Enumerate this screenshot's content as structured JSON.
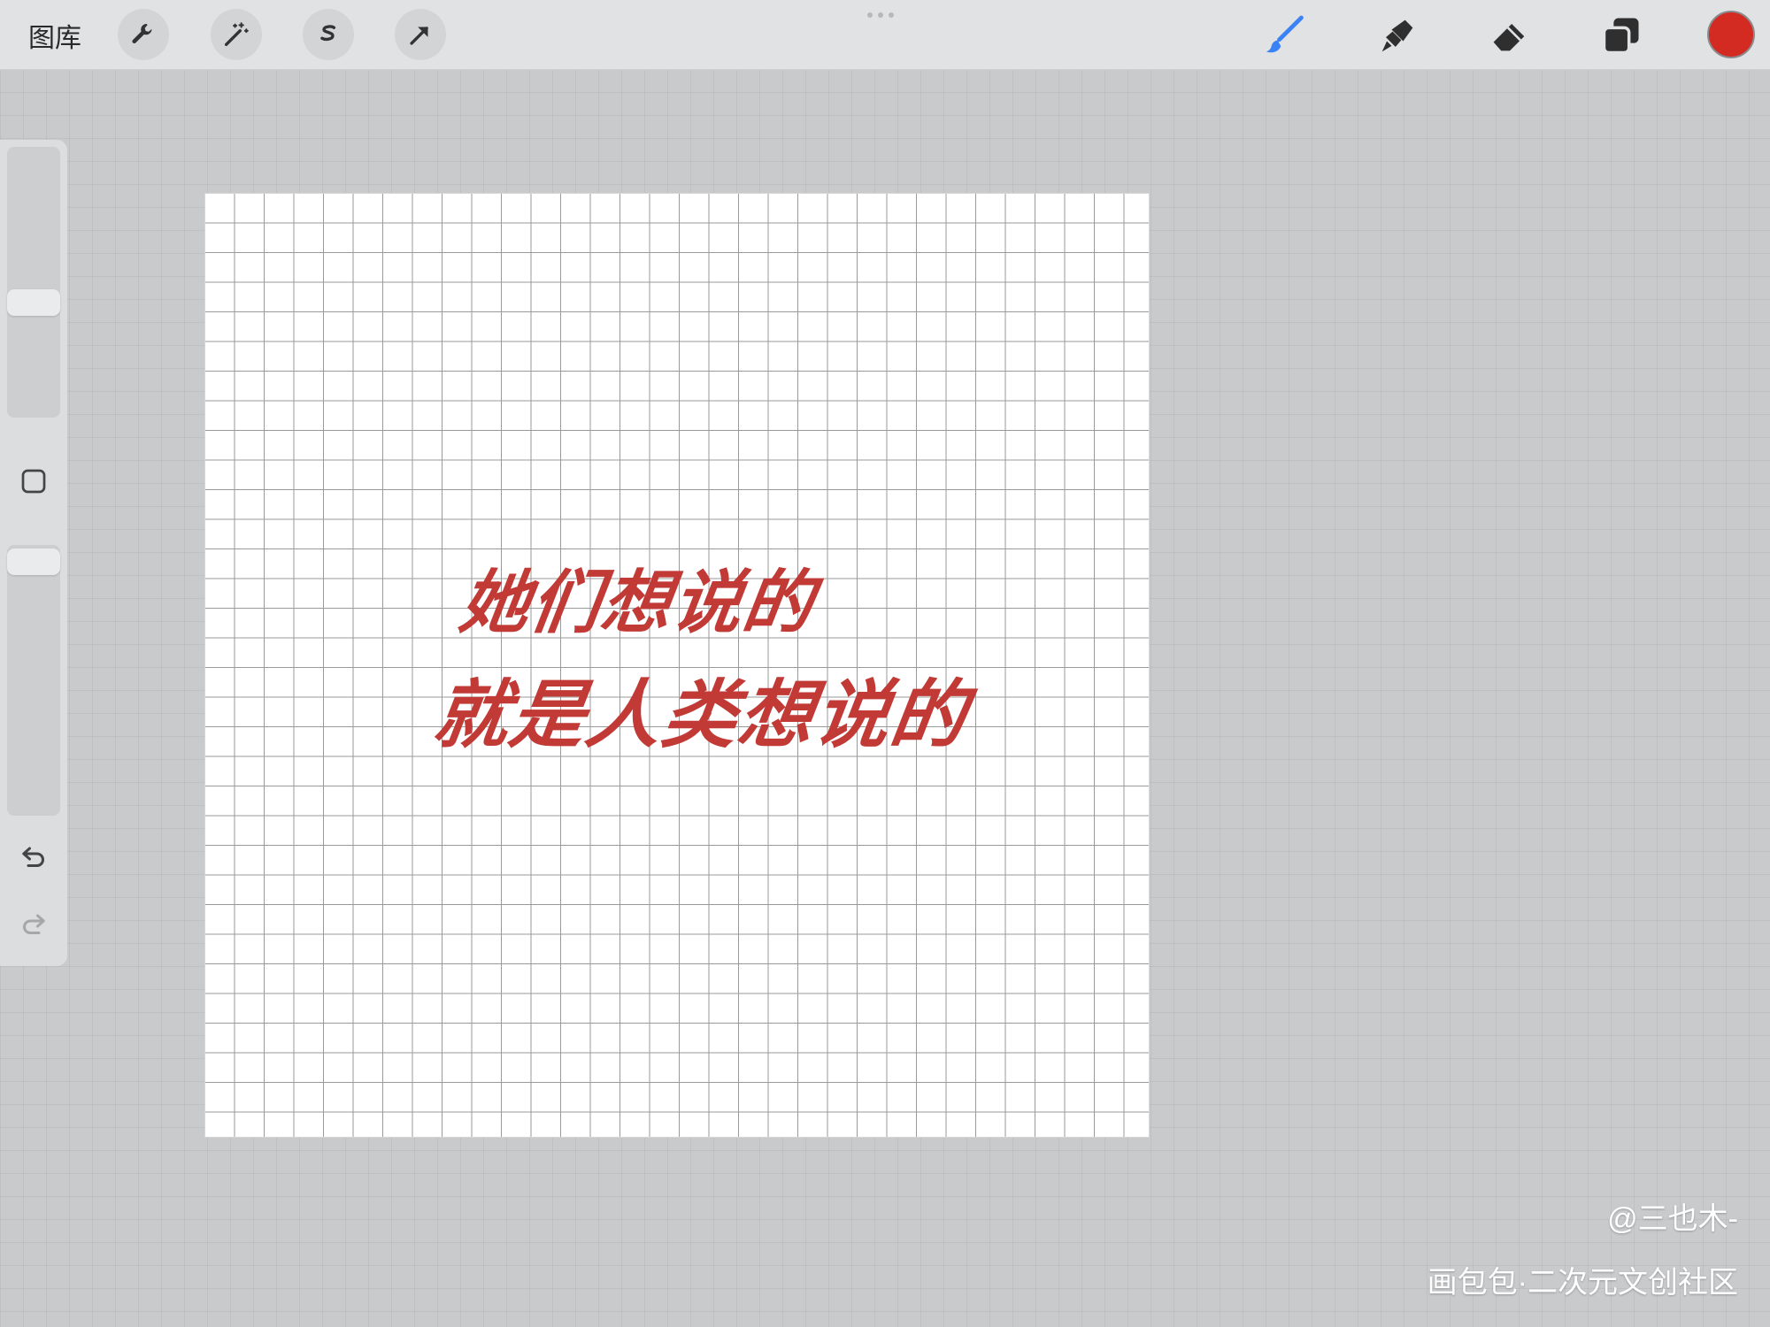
{
  "topbar": {
    "gallery_label": "图库",
    "left_tools": [
      "wrench-icon",
      "magic-wand-icon",
      "selection-icon",
      "transform-arrow-icon"
    ],
    "right_tools": [
      "brush-icon",
      "smudge-icon",
      "eraser-icon",
      "layers-icon"
    ],
    "active_tool": "brush",
    "active_color": "#d32a22",
    "accent_color": "#3b82f6"
  },
  "sidebar": {
    "brush_size_level": 0.42,
    "opacity_level": 0.95,
    "modify_button": "square-modify-icon",
    "undo": "undo-icon",
    "redo": "redo-icon"
  },
  "canvas": {
    "text_line1": "她们想说的",
    "text_line2": "就是人类想说的",
    "ink_color": "#c13a35"
  },
  "watermark": {
    "author": "@三也木-",
    "site": "画包包·二次元文创社区"
  }
}
